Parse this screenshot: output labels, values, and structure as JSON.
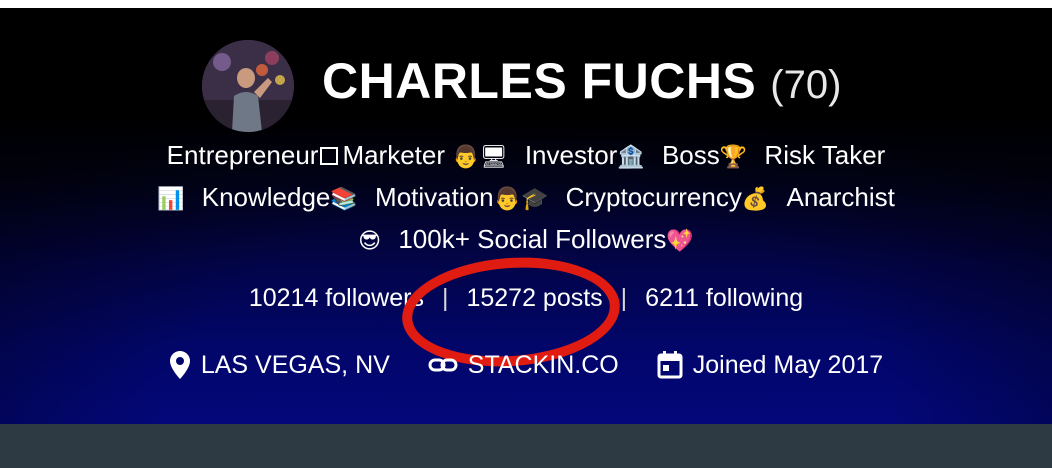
{
  "profile": {
    "name": "CHARLES FUCHS",
    "age": "(70)"
  },
  "bio": {
    "line1": {
      "w1": "Entrepreneur",
      "w2": "Marketer",
      "w3": "Investor",
      "w4": "Boss",
      "w5": "Risk Taker"
    },
    "line2": {
      "w1": "Knowledge",
      "w2": "Motivation",
      "w3": "Cryptocurrency",
      "w4": "Anarchist"
    },
    "line3": {
      "w1": "100k+ Social Followers"
    }
  },
  "stats": {
    "followers": "10214 followers",
    "posts": "15272 posts",
    "following": "6211 following",
    "separator": "|"
  },
  "meta": {
    "location": "LAS VEGAS, NV",
    "website": "STACKIN.CO",
    "joined": "Joined May 2017"
  },
  "icons": [
    "location-pin-icon",
    "link-icon",
    "calendar-icon"
  ],
  "colors": {
    "header_top": "#000000",
    "header_bottom": "#03077a",
    "bottom_bar": "#2e3a43",
    "annotation": "#e01b12",
    "text": "#ffffff"
  }
}
